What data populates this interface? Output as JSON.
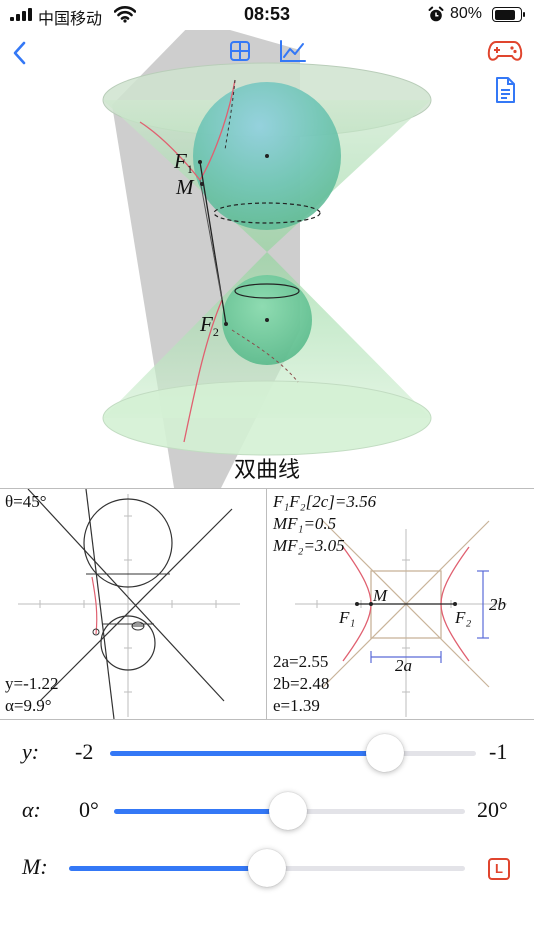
{
  "status_bar": {
    "carrier": "中国移动",
    "time": "08:53",
    "battery": "80%",
    "battery_level": 0.8
  },
  "toolbar": {
    "back_icon": "chevron-left-icon",
    "grid_icon": "grid-icon",
    "chart_icon": "line-chart-icon",
    "game_icon": "gamepad-icon",
    "document_icon": "document-icon",
    "accent_color": "#3478f6",
    "red_color": "#e0452e"
  },
  "scene": {
    "title": "双曲线",
    "label_F1": "F",
    "label_F1_sub": "1",
    "label_M": "M",
    "label_F2": "F",
    "label_F2_sub": "2"
  },
  "left_panel": {
    "theta": "θ=45°",
    "y": "y=-1.22",
    "alpha": "α=9.9°"
  },
  "right_panel": {
    "F1F2_label": "F₁F₂[2c]=3.56",
    "MF1_label": "MF₁=0.5",
    "MF2_label": "MF₂=3.05",
    "a2": "2a=2.55",
    "b2": "2b=2.48",
    "e": "e=1.39",
    "label_M": "M",
    "label_F1": "F₁",
    "label_F2": "F₂",
    "label_2a": "2a",
    "label_2b": "2b"
  },
  "sliders": {
    "y": {
      "label": "y:",
      "min": "-2",
      "max": "-1",
      "value": 0.75
    },
    "alpha": {
      "label": "α:",
      "min": "0°",
      "max": "20°",
      "value": 0.495
    },
    "M": {
      "label": "M:",
      "value": 0.5,
      "lock_label": "L"
    }
  }
}
